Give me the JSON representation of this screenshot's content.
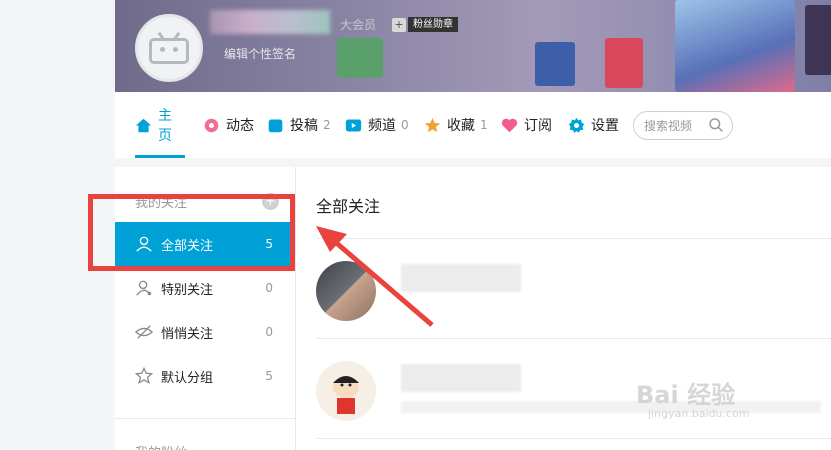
{
  "profile": {
    "vip_label": "大会员",
    "fan_badge": "粉丝勋章",
    "fan_badge_plus": "+",
    "signature_placeholder": "编辑个性签名"
  },
  "nav": {
    "items": [
      {
        "label": "主页",
        "count": "",
        "icon": "home-icon",
        "color": "#00a1d6"
      },
      {
        "label": "动态",
        "count": "",
        "icon": "flower-icon",
        "color": "#f06e92"
      },
      {
        "label": "投稿",
        "count": "2",
        "icon": "upload-icon",
        "color": "#00a1d6"
      },
      {
        "label": "频道",
        "count": "0",
        "icon": "channel-icon",
        "color": "#00a1d6"
      },
      {
        "label": "收藏",
        "count": "1",
        "icon": "star-icon",
        "color": "#f3a034"
      },
      {
        "label": "订阅",
        "count": "",
        "icon": "heart-icon",
        "color": "#f25d8e"
      },
      {
        "label": "设置",
        "count": "",
        "icon": "gear-icon",
        "color": "#00a1d6"
      }
    ],
    "search_placeholder": "搜索视频"
  },
  "sidebar": {
    "header": "我的关注",
    "header_plus": "+",
    "items": [
      {
        "label": "全部关注",
        "count": "5",
        "icon": "person-icon"
      },
      {
        "label": "特别关注",
        "count": "0",
        "icon": "special-person-icon"
      },
      {
        "label": "悄悄关注",
        "count": "0",
        "icon": "eye-hidden-icon"
      },
      {
        "label": "默认分组",
        "count": "5",
        "icon": "star-outline-icon"
      }
    ],
    "footer": "我的粉丝"
  },
  "main": {
    "title": "全部关注"
  },
  "watermark": {
    "brand": "Bai 经验",
    "url": "jingyan.baidu.com"
  },
  "colors": {
    "accent": "#00a1d6",
    "annotation": "#e8433d"
  }
}
